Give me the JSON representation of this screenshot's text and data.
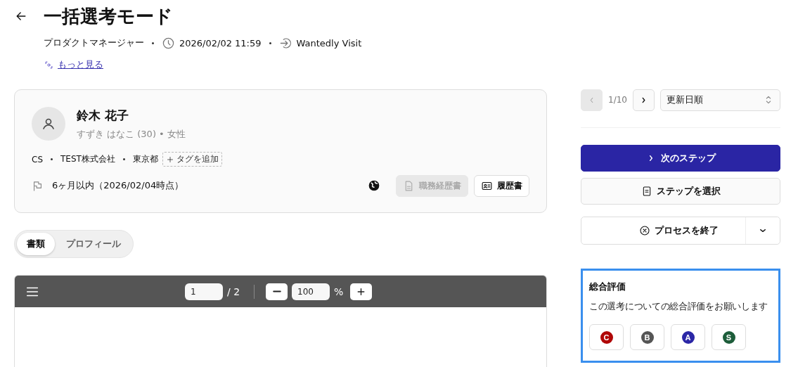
{
  "header": {
    "title": "一括選考モード",
    "job": "プロダクトマネージャー",
    "datetime": "2026/02/02 11:59",
    "source": "Wantedly Visit",
    "more_link": "もっと見る"
  },
  "candidate": {
    "name": "鈴木 花子",
    "subtitle": "すずき はなこ (30) • 女性",
    "tags": [
      "CS",
      "TEST株式会社",
      "東京都"
    ],
    "add_tag": "タグを追加",
    "period": "6ヶ月以内（2026/02/04時点）",
    "documents": [
      {
        "label": "職務経歴書",
        "kind": "career",
        "disabled": true
      },
      {
        "label": "履歴書",
        "kind": "resume",
        "disabled": false
      }
    ]
  },
  "tabs": [
    {
      "label": "書類",
      "selected": true
    },
    {
      "label": "プロフィール",
      "selected": false
    }
  ],
  "viewer": {
    "page": "1",
    "page_total": "/ 2",
    "zoom": "100",
    "zoom_unit": "%"
  },
  "pager": {
    "prev_disabled": true,
    "position": "1/10",
    "next_disabled": false
  },
  "sort": {
    "value": "更新日順"
  },
  "actions": [
    {
      "label": "次のステップ",
      "kind": "primary"
    },
    {
      "label": "ステップを選択",
      "kind": "select"
    },
    {
      "label": "プロセスを終了",
      "kind": "end"
    }
  ],
  "evaluation": {
    "title": "総合評価",
    "prompt": "この選考についての総合評価をお願いします",
    "grades": [
      {
        "label": "C",
        "color": "#b00707"
      },
      {
        "label": "B",
        "color": "#555555"
      },
      {
        "label": "A",
        "color": "#2b27a6"
      },
      {
        "label": "S",
        "color": "#1d5d3a"
      }
    ]
  }
}
